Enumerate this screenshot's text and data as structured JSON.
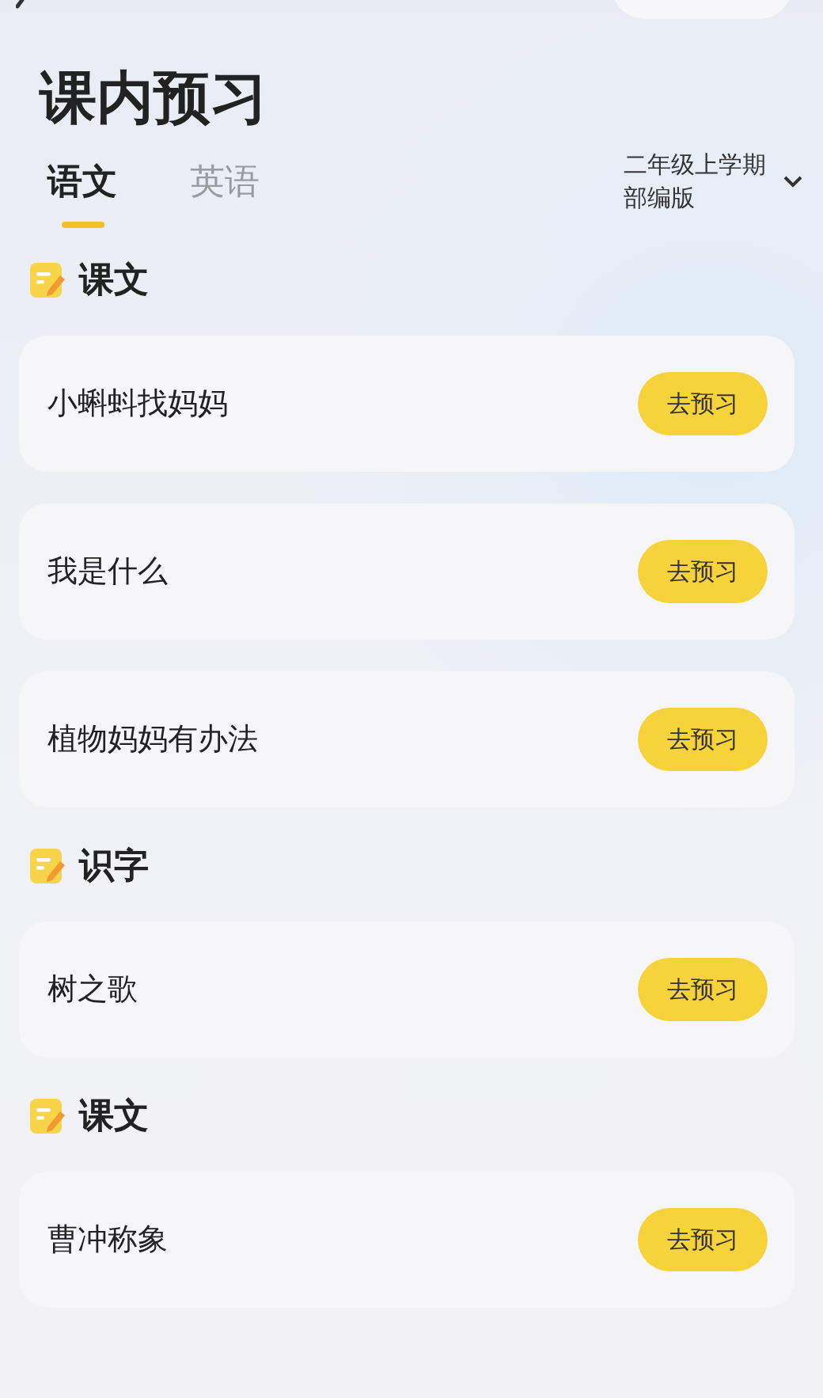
{
  "header": {
    "title": "课内预习"
  },
  "tabs": [
    {
      "label": "语文",
      "selected": true
    },
    {
      "label": "英语",
      "selected": false
    }
  ],
  "grade_selector": {
    "grade": "二年级上学期",
    "edition": "部编版"
  },
  "sections": [
    {
      "title": "课文",
      "lessons": [
        {
          "name": "小蝌蚪找妈妈",
          "action": "去预习"
        },
        {
          "name": "我是什么",
          "action": "去预习"
        },
        {
          "name": "植物妈妈有办法",
          "action": "去预习"
        }
      ]
    },
    {
      "title": "识字",
      "lessons": [
        {
          "name": "树之歌",
          "action": "去预习"
        }
      ]
    },
    {
      "title": "课文",
      "lessons": [
        {
          "name": "曹冲称象",
          "action": "去预习"
        }
      ]
    }
  ]
}
